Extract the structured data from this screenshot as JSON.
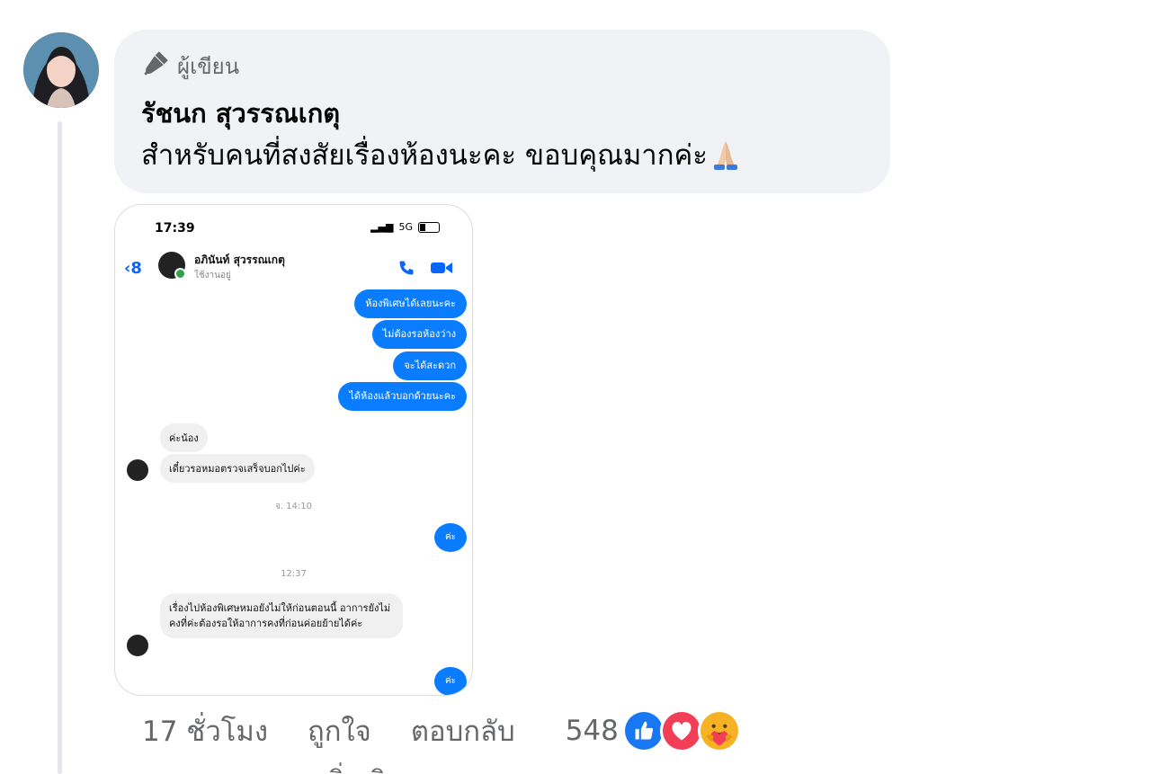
{
  "comment": {
    "badge_label": "ผู้เขียน",
    "author": "รัชนก สุวรรณเกตุ",
    "text": "สำหรับคนที่สงสัยเรื่องห้องนะคะ ขอบคุณมากค่ะ",
    "emoji": "folded-hands"
  },
  "screenshot": {
    "time": "17:39",
    "signal": "5G",
    "contact_name": "อภินันท์ สุวรรณเกตุ",
    "contact_status": "ใช้งานอยู่",
    "outgoing": [
      "ห้องพิเศษได้เลยนะคะ",
      "ไม่ต้องรอห้องว่าง",
      "จะได้สะดวก",
      "ได้ห้องแล้วบอกด้วยนะคะ"
    ],
    "incoming_1": "ค่ะน้อง",
    "incoming_2": "เดี๋ยวรอหมอตรวจเสร็จบอกไปค่ะ",
    "time_divider_1": "จ. 14:10",
    "reply_dot_1": "ค่ะ",
    "time_divider_2": "12:37",
    "incoming_3": "เรื่องไปห้องพิเศษหมอยังไม่ให้ก่อนตอนนี้ อาการยังไม่คงที่ค่ะต้องรอให้อาการคงที่ก่อนค่อยย้ายได้ค่ะ",
    "reply_dot_2": "ค่ะ"
  },
  "actions": {
    "time": "17 ชั่วโมง",
    "like": "ถูกใจ",
    "reply": "ตอบกลับ",
    "reaction_count": "548",
    "reactions": [
      "like",
      "love",
      "care"
    ]
  },
  "below_text": "ดูเพิ่มเติม",
  "colors": {
    "accent": "#0866ff",
    "bubble": "#f0f2f5",
    "muted": "#65676b"
  }
}
